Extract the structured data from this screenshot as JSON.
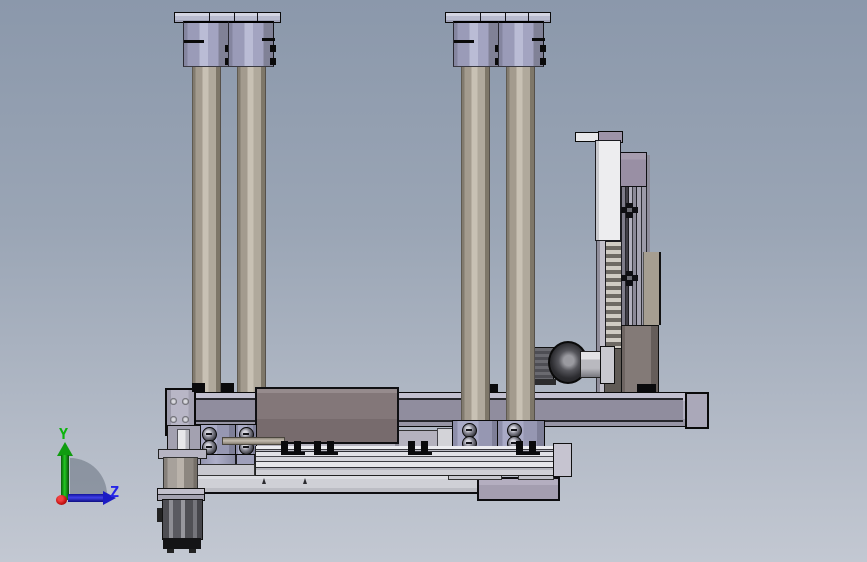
{
  "viewport": {
    "type": "cad-3d-view",
    "view": "side",
    "visible_text": [
      "Y",
      "Z"
    ]
  },
  "triad": {
    "y_label": "Y",
    "z_label": "Z",
    "y_color": "#0cb40c",
    "z_color": "#2222e0",
    "x_color": "#c41212",
    "arc_color": "rgba(95,105,120,0.55)"
  },
  "colors": {
    "bg_top": "#8b98ab",
    "bg_bottom": "#c3c8d2",
    "outline": "#0f0f12",
    "metal_lavender": "#a9abc6",
    "rod_tan": "#beb6aa",
    "beam_body": "#b1afc0",
    "beam_face": "#908d9e",
    "box_brown": "#7e7274",
    "plate_light": "#d0d1d7",
    "rail_light": "#e9e9ed",
    "white_plate": "#ededef",
    "panel_purple": "#998fa4",
    "column_tan": "#a69e91",
    "carriage_gray": "#7b7270",
    "motor_dark": "#55555a",
    "motor_black": "#141416"
  }
}
